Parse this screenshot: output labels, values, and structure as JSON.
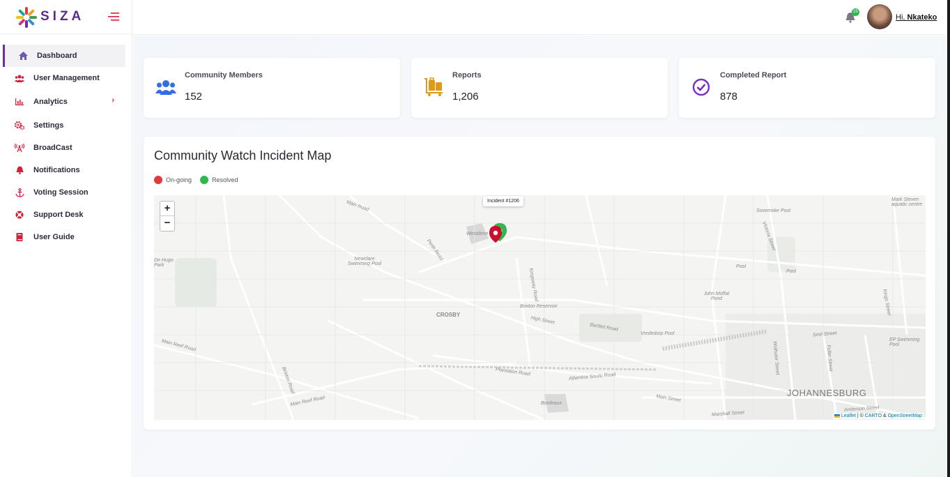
{
  "brand": {
    "name": "SIZA",
    "text_color": "#5a2d8c"
  },
  "sidebar": {
    "items": [
      {
        "label": "Dashboard",
        "icon": "home-icon",
        "active": true
      },
      {
        "label": "User Management",
        "icon": "users-icon"
      },
      {
        "label": "Analytics",
        "icon": "bar-chart-icon",
        "has_submenu": true
      },
      {
        "label": "Settings",
        "icon": "gears-icon"
      },
      {
        "label": "BroadCast",
        "icon": "broadcast-tower-icon"
      },
      {
        "label": "Notifications",
        "icon": "bell-icon"
      },
      {
        "label": "Voting Session",
        "icon": "anchor-icon"
      },
      {
        "label": "Support Desk",
        "icon": "lifebuoy-icon"
      },
      {
        "label": "User Guide",
        "icon": "book-icon"
      }
    ],
    "accent_color": "#d31f3c",
    "active_color": "#6d2fa8"
  },
  "header": {
    "greeting_prefix": "Hi,",
    "user_name": "Nkateko",
    "notification_badge": "25",
    "badge_color": "#2eb84e"
  },
  "stats": [
    {
      "label": "Community Members",
      "value": "152",
      "icon": "users-icon",
      "color": "#2f6fe0"
    },
    {
      "label": "Reports",
      "value": "1,206",
      "icon": "luggage-cart-icon",
      "color": "#e09a1a"
    },
    {
      "label": "Completed Report",
      "value": "878",
      "icon": "check-circle-icon",
      "color": "#7a2fc4"
    }
  ],
  "map_panel": {
    "title": "Community Watch Incident Map",
    "legend": [
      {
        "label": "On-going",
        "color": "#e23a3a"
      },
      {
        "label": "Resolved",
        "color": "#2eb84e"
      }
    ],
    "tooltip": "Incident #1206",
    "zoom_in": "+",
    "zoom_out": "−",
    "attribution": {
      "leaflet": "Leaflet",
      "separator": " | © ",
      "carto": "CARTO",
      "amp": " & ",
      "osm": "OpenStreetMap"
    },
    "places": {
      "city": "JOHANNESBURG",
      "crosby": "CROSBY",
      "pool1": "Newclare Swimming Pool",
      "pool2": "Vrededorp Pool",
      "pool3": "John Moffat Pond",
      "pool4": "EP Swimming Pool",
      "pool5": "Sovemoke Pool",
      "pool6": "Mark Steven aquatic centre",
      "reservoir": "Brixton Reservoir",
      "westdene": "Westdene",
      "pool7": "Pool",
      "pool8": "Pool",
      "hugo": "De Hugo Park",
      "street1": "Main Road",
      "street2": "High Street",
      "street3": "Main Reef Road",
      "street4": "Albertina Sisulu Road",
      "street5": "Smit Street",
      "street6": "Bartlett Road",
      "street7": "Perth Road",
      "street8": "Kingsway Road",
      "street9": "Fuller Street",
      "street10": "Main Street",
      "street11": "Marshall Street",
      "street12": "Anderson Street",
      "street13": "Plantation Road",
      "street14": "Kings Street",
      "street15": "Wolhuter Street",
      "street16": "Victoria Street",
      "street17": "Bordeaux",
      "street18": "Main Reef Road",
      "street19": "Brixton Road"
    }
  }
}
